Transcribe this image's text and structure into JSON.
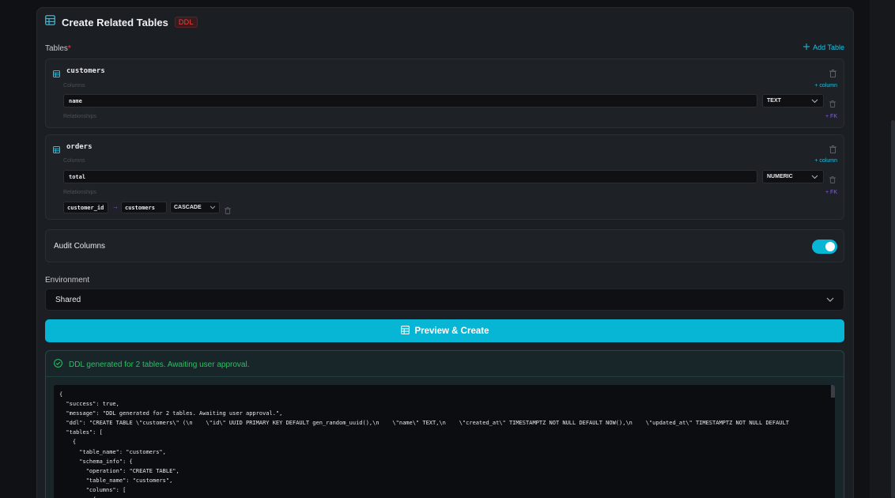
{
  "header": {
    "title": "Create Related Tables",
    "badge": "DDL"
  },
  "tables_section": {
    "label": "Tables",
    "required_mark": "*",
    "add_table_label": "Add Table"
  },
  "tables": [
    {
      "name": "customers",
      "columns_label": "Columns",
      "add_column_label": "+ column",
      "columns": [
        {
          "name": "name",
          "type": "TEXT"
        }
      ],
      "relationships_label": "Relationships",
      "add_fk_label": "+ FK"
    },
    {
      "name": "orders",
      "columns_label": "Columns",
      "add_column_label": "+ column",
      "columns": [
        {
          "name": "total",
          "type": "NUMERIC"
        }
      ],
      "relationships_label": "Relationships",
      "add_fk_label": "+ FK",
      "relationships": [
        {
          "column": "customer_id",
          "arrow": "→",
          "references": "customers",
          "on_delete": "CASCADE"
        }
      ]
    }
  ],
  "audit": {
    "label": "Audit Columns",
    "enabled": true
  },
  "environment": {
    "label": "Environment",
    "value": "Shared"
  },
  "primary_button": {
    "label": "Preview & Create"
  },
  "result": {
    "status": "DDL generated for 2 tables. Awaiting user approval.",
    "code": "{\n  \"success\": true,\n  \"message\": \"DDL generated for 2 tables. Awaiting user approval.\",\n  \"ddl\": \"CREATE TABLE \\\"customers\\\" (\\n    \\\"id\\\" UUID PRIMARY KEY DEFAULT gen_random_uuid(),\\n    \\\"name\\\" TEXT,\\n    \\\"created_at\\\" TIMESTAMPTZ NOT NULL DEFAULT NOW(),\\n    \\\"updated_at\\\" TIMESTAMPTZ NOT NULL DEFAULT\n  \"tables\": [\n    {\n      \"table_name\": \"customers\",\n      \"schema_info\": {\n        \"operation\": \"CREATE TABLE\",\n        \"table_name\": \"customers\",\n        \"columns\": [\n          {"
  },
  "colors": {
    "accent": "#06b6d4",
    "success": "#22c55e",
    "danger": "#ef4444",
    "fk": "#8b5cf6"
  }
}
